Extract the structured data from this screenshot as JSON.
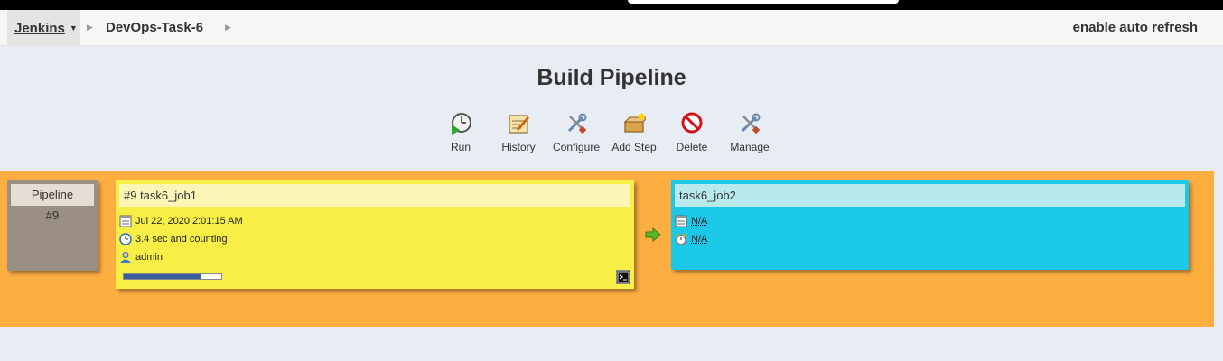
{
  "header": {
    "home_label": "Jenkins",
    "breadcrumb_job": "DevOps-Task-6",
    "auto_refresh": "enable auto refresh"
  },
  "title": "Build Pipeline",
  "toolbar": [
    {
      "label": "Run",
      "icon": "clock-run-icon"
    },
    {
      "label": "History",
      "icon": "notepad-icon"
    },
    {
      "label": "Configure",
      "icon": "wrench-screwdriver-icon"
    },
    {
      "label": "Add Step",
      "icon": "box-add-icon"
    },
    {
      "label": "Delete",
      "icon": "no-entry-icon"
    },
    {
      "label": "Manage",
      "icon": "wrench-screwdriver-icon"
    }
  ],
  "pipeline": {
    "label": "Pipeline",
    "number": "#9",
    "jobs": [
      {
        "title": "#9 task6_job1",
        "date": "Jul 22, 2020 2:01:15 AM",
        "duration": "3.4 sec and counting",
        "user": "admin",
        "progress": 0.8
      },
      {
        "title": "task6_job2",
        "date": "N/A",
        "duration": "N/A"
      }
    ]
  },
  "colors": {
    "pipeline_bg": "#fcae40",
    "running_job": "#f7ef45",
    "pending_job": "#1cc8e8",
    "header_box": "#9b8f83"
  }
}
